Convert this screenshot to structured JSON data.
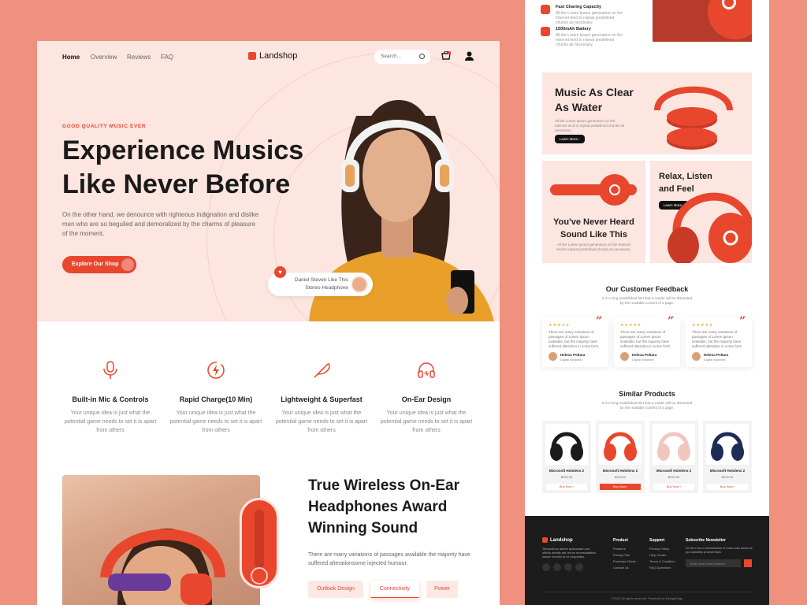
{
  "nav": {
    "home": "Home",
    "overview": "Overview",
    "reviews": "Reviews",
    "faq": "FAQ"
  },
  "brand": "Landshop",
  "search": {
    "placeholder": "Search..."
  },
  "hero": {
    "eyebrow": "GOOD QUALITY MUSIC EVER",
    "headline_line1": "Experience Musics",
    "headline_line2": "Like Never Before",
    "description": "On the other hand, we denounce with righteous indignation and dislike men who are so beguiled and demoralized by the charms of pleasure of the moment.",
    "cta": "Explore Our Shop",
    "badge_line1": "Daniel Steven Like This",
    "badge_line2": "Stereo Headphone"
  },
  "features": [
    {
      "title": "Built-in Mic & Controls",
      "desc": "Your unique idea is just what the potential game needs to set it is apart from others"
    },
    {
      "title": "Rapid Charge(10 Min)",
      "desc": "Your unique idea is just what the potential game needs to set it is apart from others"
    },
    {
      "title": "Lightweight & Superfast",
      "desc": "Your unique idea is just what the potential game needs to set it is apart from others"
    },
    {
      "title": "On-Ear Design",
      "desc": "Your unique idea is just what the potential game needs to set it is apart from others"
    }
  ],
  "award": {
    "title": "True Wireless On-Ear Headphones Award Winning Sound",
    "desc": "There are many variations of passages available the majority have suffered alterationsome injected humour.",
    "tabs": [
      "Outlook Design",
      "Connectivity",
      "Power"
    ]
  },
  "specs": [
    {
      "title": "Fast Charing Capacity",
      "desc": "All the Lorem Ipsum generators on the Internet tend to repeat predefined chunks as necessary."
    },
    {
      "title": "1500mAh Battery",
      "desc": "All the Lorem Ipsum generators on the Internet tend to repeat predefined chunks as necessary."
    }
  ],
  "promo": {
    "clear_line1": "Music As Clear",
    "clear_line2": "As Water",
    "clear_desc": "All the Lorem Ipsum generators on the Internet tend to repeat predefined chunks as necessary.",
    "learn_more": "Learn More",
    "heard_line1": "You've Never Heard",
    "heard_line2": "Sound Like This",
    "heard_desc": "All the Lorem Ipsum generators on the Internet tend to repeat predefined chunks as necessary.",
    "relax_line1": "Relax, Listen",
    "relax_line2": "and Feel"
  },
  "feedback": {
    "title": "Our Customer Feedback",
    "subtitle": "It is a long established fact that a reader will be distracted by the readable content of a page.",
    "cards": [
      {
        "text": "There are many variations of passages of Lorem Ipsum available, but the majority have suffered alteration in some form.",
        "name": "Helena Poltara",
        "role": "Digital Marketer"
      },
      {
        "text": "There are many variations of passages of Lorem Ipsum available, but the majority have suffered alteration in some form.",
        "name": "Helena Poltara",
        "role": "Digital Marketer"
      },
      {
        "text": "There are many variations of passages of Lorem Ipsum available, but the majority have suffered alteration in some form.",
        "name": "Helena Poltara",
        "role": "Digital Marketer"
      }
    ]
  },
  "similar": {
    "title": "Similar Products",
    "subtitle": "It is a long established fact that a reader will be distracted by the readable content of a page.",
    "products": [
      {
        "name": "Microsoft Hololens 2",
        "price": "$299.00",
        "button": "Buy Now",
        "color": "#1a1a1a"
      },
      {
        "name": "Microsoft Hololens 2",
        "price": "$299.00",
        "button": "Buy Now",
        "color": "#e8472e"
      },
      {
        "name": "Microsoft Hololens 2",
        "price": "$299.00",
        "button": "Buy Now",
        "color": "#efc7bf"
      },
      {
        "name": "Microsoft Hololens 2",
        "price": "$299.00",
        "button": "Buy Now",
        "color": "#1c2c55"
      }
    ]
  },
  "footer": {
    "brand": "Landshop",
    "about": "Temporibus autem quibusdam aut officiis debitis aut rerum necessitatibus saepe eveniet ut et voluptates.",
    "product_title": "Product",
    "product_links": [
      "Features",
      "Pricing Plan",
      "Purchase Guide",
      "Contact Us"
    ],
    "support_title": "Support",
    "support_links": [
      "Privacy Policy",
      "Help Center",
      "Terms & Condition",
      "FAQ Questions"
    ],
    "news_title": "Subscribe Newsletter",
    "news_desc": "At vero eos et accusamus et iusto odio ducimus qui blanditiis praesentium",
    "email_placeholder": "Enter your email address",
    "copyright": "©2022 All rights reserved. Powered by DesignEdge"
  },
  "colors": {
    "accent": "#e8472e",
    "hero_bg": "#fde5e0",
    "page_bg": "#f0907e",
    "footer_bg": "#1c1c1c"
  }
}
